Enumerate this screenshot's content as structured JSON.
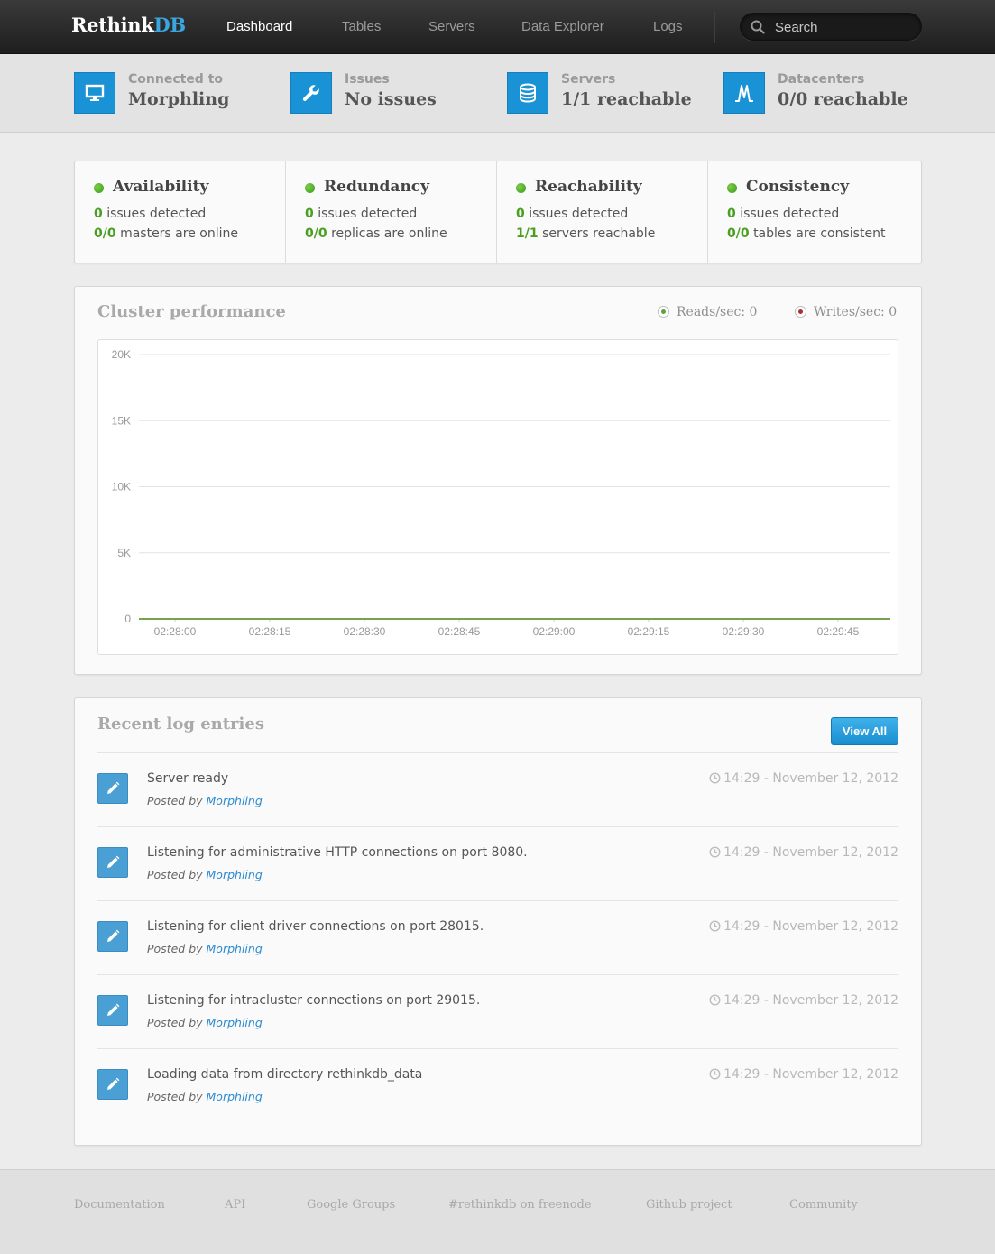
{
  "brand": {
    "name_part1": "Rethink",
    "name_part2": "DB",
    "accent": "#3aa6e0"
  },
  "nav": {
    "items": [
      {
        "label": "Dashboard",
        "active": true
      },
      {
        "label": "Tables",
        "active": false
      },
      {
        "label": "Servers",
        "active": false
      },
      {
        "label": "Data Explorer",
        "active": false
      },
      {
        "label": "Logs",
        "active": false
      }
    ],
    "search_placeholder": "Search"
  },
  "stats": [
    {
      "icon": "monitor-icon",
      "label": "Connected to",
      "value": "Morphling"
    },
    {
      "icon": "wrench-icon",
      "label": "Issues",
      "value": "No issues"
    },
    {
      "icon": "database-icon",
      "label": "Servers",
      "value": "1/1 reachable"
    },
    {
      "icon": "datacenter-icon",
      "label": "Datacenters",
      "value": "0/0 reachable"
    }
  ],
  "status": [
    {
      "title": "Availability",
      "line1_num": "0",
      "line1_text": "issues detected",
      "line2_num": "0/0",
      "line2_text": "masters are online"
    },
    {
      "title": "Redundancy",
      "line1_num": "0",
      "line1_text": "issues detected",
      "line2_num": "0/0",
      "line2_text": "replicas are online"
    },
    {
      "title": "Reachability",
      "line1_num": "0",
      "line1_text": "issues detected",
      "line2_num": "1/1",
      "line2_text": "servers reachable"
    },
    {
      "title": "Consistency",
      "line1_num": "0",
      "line1_text": "issues detected",
      "line2_num": "0/0",
      "line2_text": "tables are consistent"
    }
  ],
  "performance": {
    "title": "Cluster performance",
    "reads_label": "Reads/sec: 0",
    "writes_label": "Writes/sec: 0",
    "reads_color": "#5aa53a",
    "writes_color": "#a83232"
  },
  "chart_data": {
    "type": "line",
    "title": "Cluster performance",
    "xlabel": "",
    "ylabel": "",
    "x_ticks": [
      "02:28:00",
      "02:28:15",
      "02:28:30",
      "02:28:45",
      "02:29:00",
      "02:29:15",
      "02:29:30",
      "02:29:45"
    ],
    "y_ticks": [
      0,
      5000,
      10000,
      15000,
      20000
    ],
    "y_tick_labels": [
      "0",
      "5K",
      "10K",
      "15K",
      "20K"
    ],
    "ylim": [
      0,
      20000
    ],
    "grid": true,
    "series": [
      {
        "name": "Reads/sec",
        "color": "#5aa53a",
        "values": [
          0,
          0,
          0,
          0,
          0,
          0,
          0,
          0
        ]
      },
      {
        "name": "Writes/sec",
        "color": "#a83232",
        "values": [
          0,
          0,
          0,
          0,
          0,
          0,
          0,
          0
        ]
      }
    ]
  },
  "logs": {
    "title": "Recent log entries",
    "view_all_label": "View All",
    "posted_by_prefix": "Posted by",
    "entries": [
      {
        "message": "Server ready",
        "author": "Morphling",
        "time": "14:29 - November 12, 2012"
      },
      {
        "message": "Listening for administrative HTTP connections on port 8080.",
        "author": "Morphling",
        "time": "14:29 - November 12, 2012"
      },
      {
        "message": "Listening for client driver connections on port 28015.",
        "author": "Morphling",
        "time": "14:29 - November 12, 2012"
      },
      {
        "message": "Listening for intracluster connections on port 29015.",
        "author": "Morphling",
        "time": "14:29 - November 12, 2012"
      },
      {
        "message": "Loading data from directory rethinkdb_data",
        "author": "Morphling",
        "time": "14:29 - November 12, 2012"
      }
    ]
  },
  "footer": {
    "links": [
      "Documentation",
      "API",
      "Google Groups",
      "#rethinkdb on freenode",
      "Github project",
      "Community"
    ]
  }
}
